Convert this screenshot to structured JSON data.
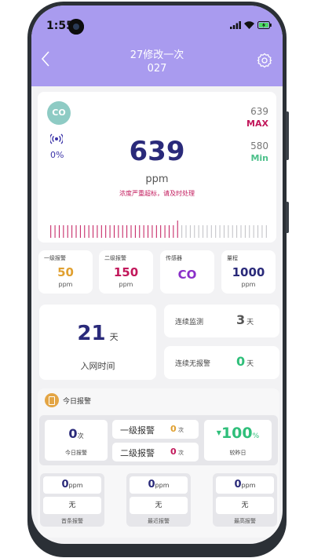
{
  "status": {
    "time": "1:55"
  },
  "header": {
    "title": "27修改一次",
    "subtitle": "027"
  },
  "sensor": {
    "badge": "CO",
    "percent": "0%",
    "value": "639",
    "unit": "ppm",
    "warning": "浓度严重超标，请及时处理",
    "max_value": "639",
    "max_label": "MAX",
    "min_value": "580",
    "min_label": "Min",
    "scale_fraction": 0.6
  },
  "small_cards": [
    {
      "label": "一级报警",
      "value": "50",
      "unit": "ppm",
      "color": "#e0a030"
    },
    {
      "label": "二级报警",
      "value": "150",
      "unit": "ppm",
      "color": "#c2185b"
    },
    {
      "label": "传感器",
      "value": "CO",
      "unit": "",
      "color": "#8a2fc8"
    },
    {
      "label": "量程",
      "value": "1000",
      "unit": "ppm",
      "color": "#2a2a7a"
    }
  ],
  "network": {
    "days": "21",
    "days_unit": "天",
    "label": "入网时间"
  },
  "monitor": {
    "label": "连续监测",
    "value": "3",
    "unit": "天"
  },
  "no_alarm": {
    "label": "连续无报警",
    "value": "0",
    "unit": "天"
  },
  "today": {
    "title": "今日报警",
    "count": "0",
    "count_unit": "次",
    "count_label": "今日报警",
    "level1_label": "一级报警",
    "level1_value": "0",
    "level1_unit": "次",
    "level2_label": "二级报警",
    "level2_value": "0",
    "level2_unit": "次",
    "change": "100",
    "change_unit": "%",
    "change_label": "较昨日"
  },
  "bottom": [
    {
      "value": "0",
      "unit": "ppm",
      "text": "无",
      "label": "首条报警"
    },
    {
      "value": "0",
      "unit": "ppm",
      "text": "无",
      "label": "最近报警"
    },
    {
      "value": "0",
      "unit": "ppm",
      "text": "无",
      "label": "最高报警"
    }
  ]
}
